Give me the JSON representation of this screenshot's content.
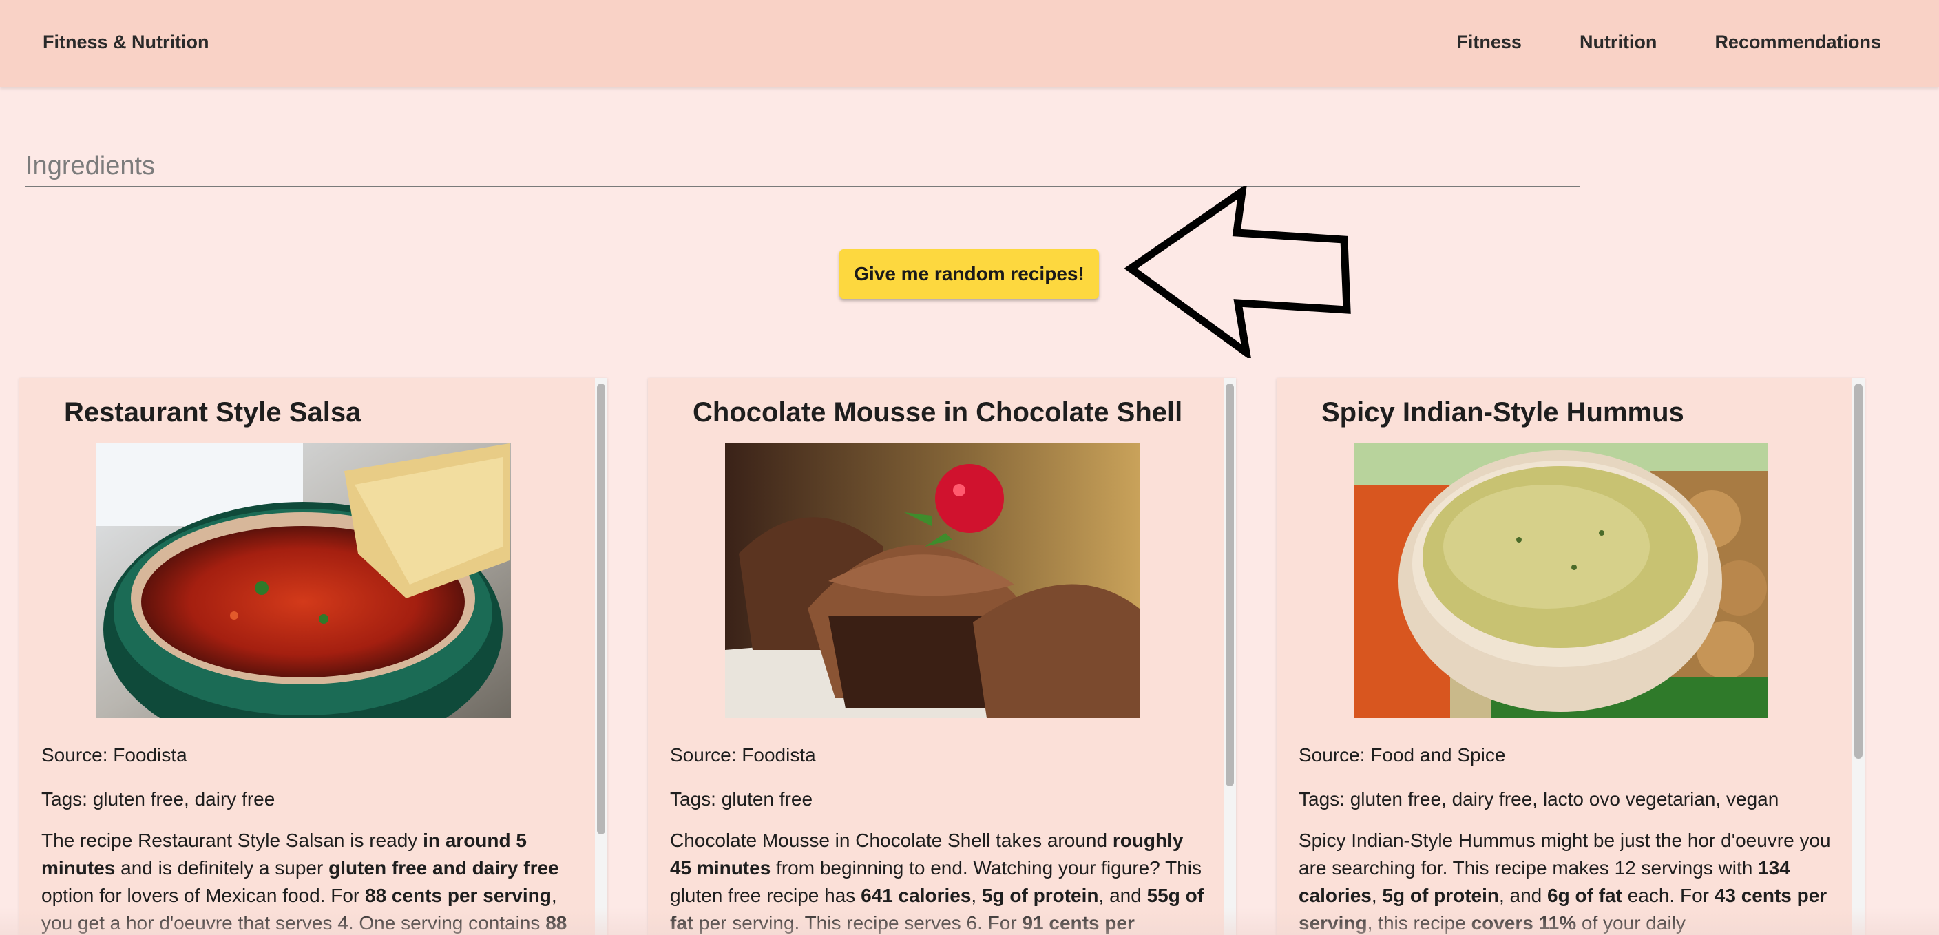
{
  "header": {
    "brand": "Fitness & Nutrition",
    "nav": [
      "Fitness",
      "Nutrition",
      "Recommendations"
    ]
  },
  "search": {
    "placeholder": "Ingredients",
    "value": ""
  },
  "random_button": {
    "label": "Give me random recipes!"
  },
  "recipes": [
    {
      "title": "Restaurant Style Salsa",
      "image_icon": "salsa-bowl-photo",
      "source": "Source: Foodista",
      "tags": "Tags: gluten free, dairy free",
      "desc": [
        {
          "t": "The recipe Restaurant Style Salsan is ready "
        },
        {
          "t": "in around 5 minutes",
          "b": true
        },
        {
          "t": " and is definitely a super "
        },
        {
          "t": "gluten free and dairy free",
          "b": true
        },
        {
          "t": " option for lovers of Mexican food. For "
        },
        {
          "t": "88 cents per serving",
          "b": true
        },
        {
          "t": ", you get a hor d'oeuvre that serves 4. One serving contains "
        },
        {
          "t": "88",
          "b": true
        }
      ]
    },
    {
      "title": "Chocolate Mousse in Chocolate Shell",
      "image_icon": "chocolate-mousse-photo",
      "source": "Source: Foodista",
      "tags": "Tags: gluten free",
      "desc": [
        {
          "t": "Chocolate Mousse in Chocolate Shell takes around "
        },
        {
          "t": "roughly 45 minutes",
          "b": true
        },
        {
          "t": " from beginning to end. Watching your figure? This gluten free recipe has "
        },
        {
          "t": "641 calories",
          "b": true
        },
        {
          "t": ", "
        },
        {
          "t": "5g of protein",
          "b": true
        },
        {
          "t": ", and "
        },
        {
          "t": "55g of fat",
          "b": true
        },
        {
          "t": " per serving. This recipe serves 6. For "
        },
        {
          "t": "91 cents per",
          "b": true
        }
      ]
    },
    {
      "title": "Spicy Indian-Style Hummus",
      "image_icon": "hummus-bowl-photo",
      "source": "Source: Food and Spice",
      "tags": "Tags: gluten free, dairy free, lacto ovo vegetarian, vegan",
      "desc": [
        {
          "t": "Spicy Indian-Style Hummus might be just the hor d'oeuvre you are searching for. This recipe makes 12 servings with "
        },
        {
          "t": "134 calories",
          "b": true
        },
        {
          "t": ", "
        },
        {
          "t": "5g of protein",
          "b": true
        },
        {
          "t": ", and "
        },
        {
          "t": "6g of fat",
          "b": true
        },
        {
          "t": " each. For "
        },
        {
          "t": "43 cents per serving",
          "b": true
        },
        {
          "t": ", this recipe "
        },
        {
          "t": "covers 11%",
          "b": true
        },
        {
          "t": " of your daily"
        }
      ]
    }
  ],
  "colors": {
    "background": "#fde9e6",
    "header": "#f9d2c6",
    "card": "#fbe0d8",
    "button": "#fdd83f"
  }
}
